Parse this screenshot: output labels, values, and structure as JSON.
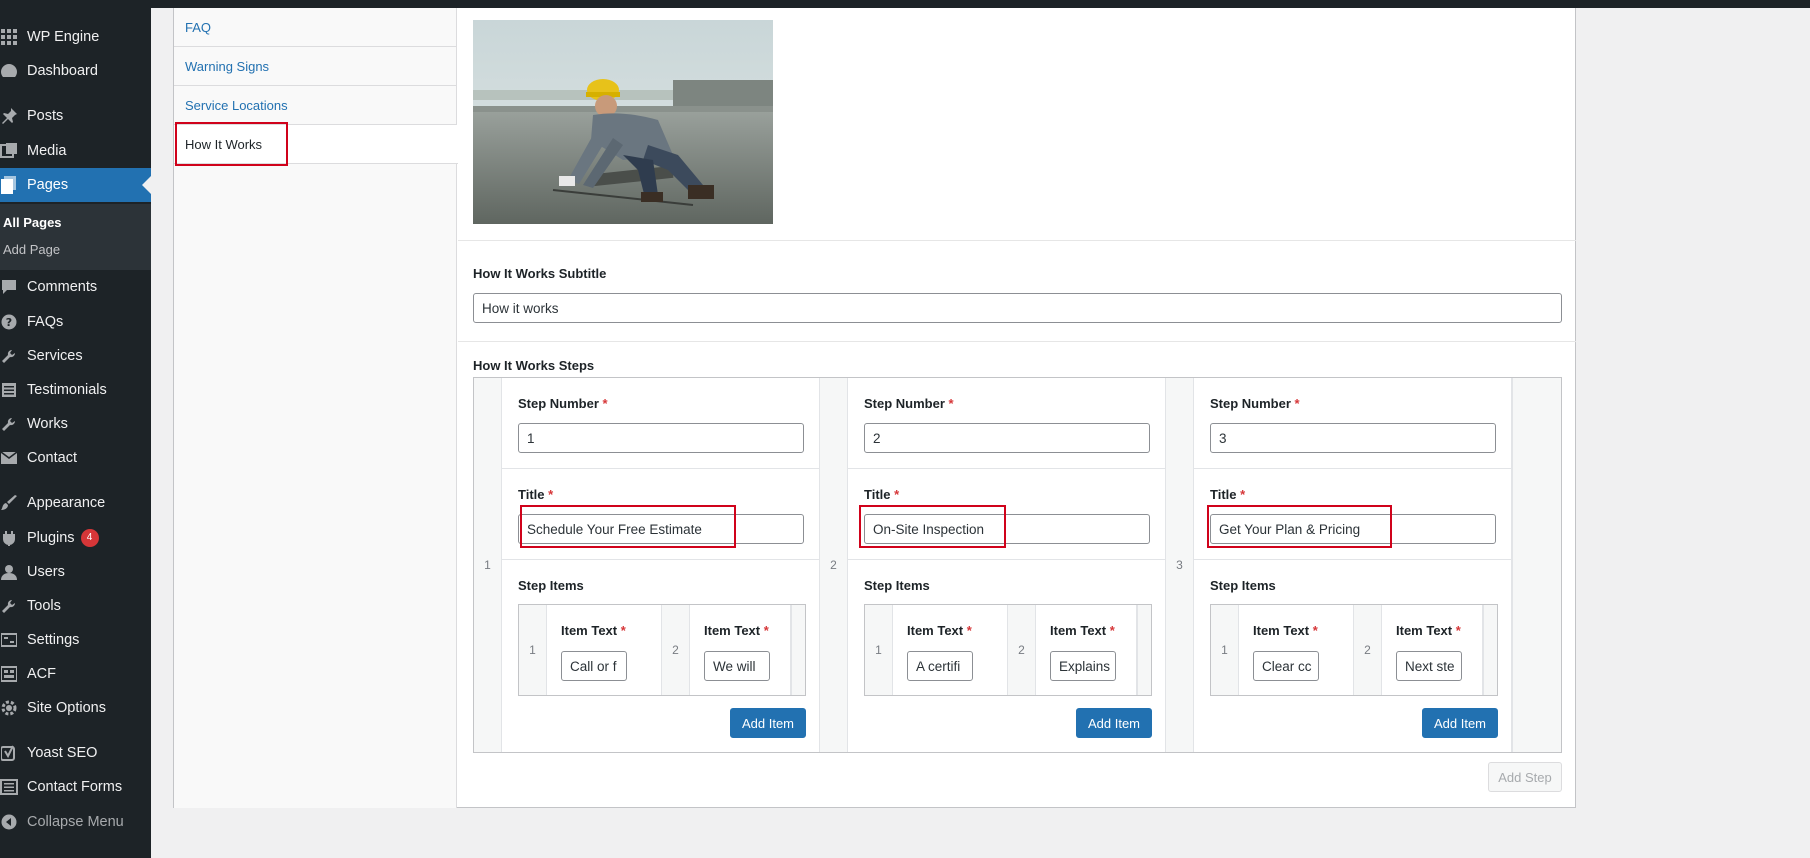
{
  "sidebar": {
    "items": [
      {
        "label": "WP Engine",
        "icon": "grid-icon"
      },
      {
        "label": "Dashboard",
        "icon": "dashboard-icon"
      },
      {
        "label": "Posts",
        "icon": "pin-icon"
      },
      {
        "label": "Media",
        "icon": "media-icon"
      },
      {
        "label": "Pages",
        "icon": "pages-icon"
      },
      {
        "label": "Comments",
        "icon": "comment-icon"
      },
      {
        "label": "FAQs",
        "icon": "help-icon"
      },
      {
        "label": "Services",
        "icon": "wrench-icon"
      },
      {
        "label": "Testimonials",
        "icon": "list-icon"
      },
      {
        "label": "Works",
        "icon": "wrench-icon"
      },
      {
        "label": "Contact",
        "icon": "mail-icon"
      },
      {
        "label": "Appearance",
        "icon": "brush-icon"
      },
      {
        "label": "Plugins",
        "icon": "plugin-icon",
        "badge": "4"
      },
      {
        "label": "Users",
        "icon": "user-icon"
      },
      {
        "label": "Tools",
        "icon": "wrench-icon"
      },
      {
        "label": "Settings",
        "icon": "settings-icon"
      },
      {
        "label": "ACF",
        "icon": "acf-icon"
      },
      {
        "label": "Site Options",
        "icon": "gear-icon"
      },
      {
        "label": "Yoast SEO",
        "icon": "yoast-icon"
      },
      {
        "label": "Contact Forms",
        "icon": "forms-icon"
      },
      {
        "label": "Collapse Menu",
        "icon": "collapse-icon"
      }
    ],
    "submenu": [
      "All Pages",
      "Add Page"
    ]
  },
  "tabs": [
    "FAQ",
    "Warning Signs",
    "Service Locations",
    "How It Works"
  ],
  "subtitle_field": {
    "label": "How It Works Subtitle",
    "value": "How it works"
  },
  "steps_field": {
    "label": "How It Works Steps",
    "step_number_label": "Step Number",
    "title_label": "Title",
    "step_items_label": "Step Items",
    "item_text_label": "Item Text",
    "required_mark": "*",
    "add_item_label": "Add Item",
    "add_step_label": "Add Step",
    "steps": [
      {
        "row": "1",
        "number": "1",
        "title": "Schedule Your Free Estimate",
        "items": [
          {
            "row": "1",
            "text": "Call or f"
          },
          {
            "row": "2",
            "text": "We will"
          }
        ]
      },
      {
        "row": "2",
        "number": "2",
        "title": "On-Site Inspection",
        "items": [
          {
            "row": "1",
            "text": "A certifi"
          },
          {
            "row": "2",
            "text": "Explains"
          }
        ]
      },
      {
        "row": "3",
        "number": "3",
        "title": "Get Your Plan & Pricing",
        "items": [
          {
            "row": "1",
            "text": "Clear cc"
          },
          {
            "row": "2",
            "text": "Next ste"
          }
        ]
      }
    ]
  },
  "colors": {
    "sidebar": "#1d2327",
    "accent": "#2271b1",
    "highlight": "#d0021b",
    "badge": "#d63638"
  }
}
